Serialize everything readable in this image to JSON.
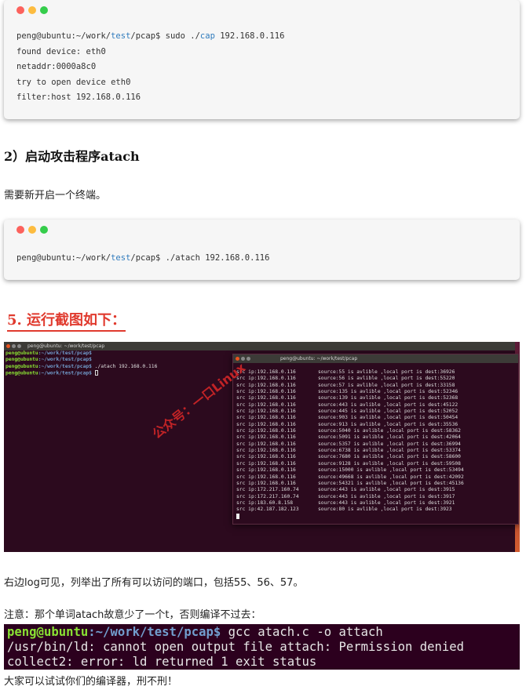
{
  "codebox1": {
    "lines": [
      {
        "pre": "peng@ubuntu:~/work/",
        "hl": "test",
        "mid": "/pcap$ sudo ./",
        "hl2": "cap",
        "post": " 192.168.0.116"
      },
      {
        "text": "found device: eth0"
      },
      {
        "text": "netaddr:0000a8c0"
      },
      {
        "text": "try to open device eth0"
      },
      {
        "text": "filter:host 192.168.0.116"
      }
    ]
  },
  "heading2": "2）启动攻击程序atach",
  "para_new_terminal": "需要新开启一个终端。",
  "codebox2": {
    "pre": "peng@ubuntu:~/work/",
    "hl": "test",
    "post": "/pcap$ ./atach 192.168.0.116"
  },
  "heading5": "5. 运行截图如下：",
  "screenshot": {
    "term1_title": "peng@ubuntu: ~/work/test/pcap",
    "term1_lines": [
      {
        "prompt": "peng@ubuntu",
        "path": ":~/work/test/pcap$",
        "cmd": ""
      },
      {
        "prompt": "peng@ubuntu",
        "path": ":~/work/test/pcap$",
        "cmd": ""
      },
      {
        "prompt": "peng@ubuntu",
        "path": ":~/work/test/pcap$",
        "cmd": " ./atach 192.168.0.116"
      },
      {
        "prompt": "peng@ubuntu",
        "path": ":~/work/test/pcap$",
        "cmd": " "
      }
    ],
    "term2_title": "peng@ubuntu: ~/work/test/pcap",
    "log": [
      {
        "src": "src ip:192.168.0.116",
        "msg": "source:55 is avlible ,local port is dest:36926"
      },
      {
        "src": "src ip:192.168.0.116",
        "msg": "source:56 is avlible ,local port is dest:55220"
      },
      {
        "src": "src ip:192.168.0.116",
        "msg": "source:57 is avlible ,local port is dest:33158"
      },
      {
        "src": "src ip:192.168.0.116",
        "msg": "source:135 is avlible ,local port is dest:52346"
      },
      {
        "src": "src ip:192.168.0.116",
        "msg": "source:139 is avlible ,local port is dest:52368"
      },
      {
        "src": "src ip:192.168.0.116",
        "msg": "source:443 is avlible ,local port is dest:45122"
      },
      {
        "src": "src ip:192.168.0.116",
        "msg": "source:445 is avlible ,local port is dest:52052"
      },
      {
        "src": "src ip:192.168.0.116",
        "msg": "source:903 is avlible ,local port is dest:50454"
      },
      {
        "src": "src ip:192.168.0.116",
        "msg": "source:913 is avlible ,local port is dest:35536"
      },
      {
        "src": "src ip:192.168.0.116",
        "msg": "source:5040 is avlible ,local port is dest:58362"
      },
      {
        "src": "src ip:192.168.0.116",
        "msg": "source:5091 is avlible ,local port is dest:42064"
      },
      {
        "src": "src ip:192.168.0.116",
        "msg": "source:5357 is avlible ,local port is dest:36994"
      },
      {
        "src": "src ip:192.168.0.116",
        "msg": "source:6738 is avlible ,local port is dest:53374"
      },
      {
        "src": "src ip:192.168.0.116",
        "msg": "source:7680 is avlible ,local port is dest:58600"
      },
      {
        "src": "src ip:192.168.0.116",
        "msg": "source:9128 is avlible ,local port is dest:59508"
      },
      {
        "src": "src ip:192.168.0.116",
        "msg": "source:15000 is avlible ,local port is dest:53494"
      },
      {
        "src": "src ip:192.168.0.116",
        "msg": "source:49668 is avlible ,local port is dest:42092"
      },
      {
        "src": "src ip:192.168.0.116",
        "msg": "source:54321 is avlible ,local port is dest:45136"
      },
      {
        "src": "src ip:172.217.160.74",
        "msg": "source:443 is avlible ,local port is dest:3915"
      },
      {
        "src": "src ip:172.217.160.74",
        "msg": "source:443 is avlible ,local port is dest:3917"
      },
      {
        "src": "src ip:183.60.8.158",
        "msg": "source:443 is avlible ,local port is dest:3921"
      },
      {
        "src": "src ip:42.187.182.123",
        "msg": "source:80 is avlible ,local port is dest:3923"
      }
    ],
    "watermark": "公众号：一口Linux"
  },
  "para_log": "右边log可见，列举出了所有可以访问的端口，包括55、56、57。",
  "para_note": "注意：那个单词atach故意少了一个t，否则编译不过去：",
  "errterm": {
    "prompt": "peng@ubuntu",
    "path": ":~/work/test/pcap$",
    "cmd": " gcc atach.c -o attach",
    "line2": "/usr/bin/ld: cannot open output file attach: Permission denied",
    "line3": "collect2: error: ld returned 1 exit status"
  },
  "para_try": "大家可以试试你们的编译器，刑不刑！"
}
